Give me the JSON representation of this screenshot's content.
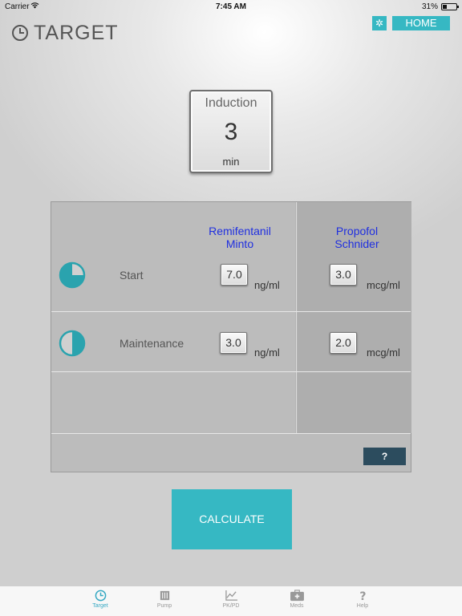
{
  "status_bar": {
    "carrier": "Carrier",
    "time": "7:45 AM",
    "battery": "31%"
  },
  "header": {
    "title": "TARGET",
    "settings_label": "✲",
    "home_label": "HOME"
  },
  "induction": {
    "label": "Induction",
    "value": "3",
    "unit": "min"
  },
  "table": {
    "drugs": [
      {
        "line1": "Remifentanil",
        "line2": "Minto"
      },
      {
        "line1": "Propofol",
        "line2": "Schnider"
      }
    ],
    "rows": [
      {
        "label": "Start",
        "remifentanil": {
          "value": "7.0",
          "unit": "ng/ml"
        },
        "propofol": {
          "value": "3.0",
          "unit": "mcg/ml"
        }
      },
      {
        "label": "Maintenance",
        "remifentanil": {
          "value": "3.0",
          "unit": "ng/ml"
        },
        "propofol": {
          "value": "2.0",
          "unit": "mcg/ml"
        }
      }
    ],
    "help_label": "?"
  },
  "calculate_label": "CALCULATE",
  "colors": {
    "accent": "#36b8c3",
    "drug_text": "#1f2fe0",
    "help_button": "#2c4c5e"
  },
  "tabs": [
    {
      "label": "Target",
      "icon": "clock-icon",
      "active": true
    },
    {
      "label": "Pump",
      "icon": "pump-icon",
      "active": false
    },
    {
      "label": "PK/PD",
      "icon": "chart-icon",
      "active": false
    },
    {
      "label": "Meds",
      "icon": "medkit-icon",
      "active": false
    },
    {
      "label": "Help",
      "icon": "question-icon",
      "active": false
    }
  ]
}
